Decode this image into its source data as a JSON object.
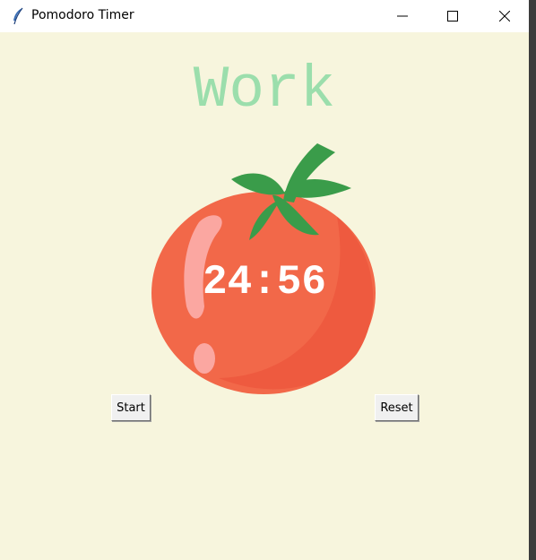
{
  "window": {
    "title": "Pomodoro Timer",
    "icon": "feather-icon"
  },
  "window_controls": {
    "minimize_icon": "minimize-icon",
    "maximize_icon": "maximize-icon",
    "close_icon": "close-icon"
  },
  "timer": {
    "mode_label": "Work",
    "time_text": "24:56",
    "image": "tomato-icon"
  },
  "buttons": {
    "start_label": "Start",
    "reset_label": "Reset"
  },
  "colors": {
    "background": "#f7f5dd",
    "mode_label": "#9bdeac",
    "tomato": "#f26849",
    "leaves": "#3a9c4a",
    "timer_text": "#ffffff"
  }
}
